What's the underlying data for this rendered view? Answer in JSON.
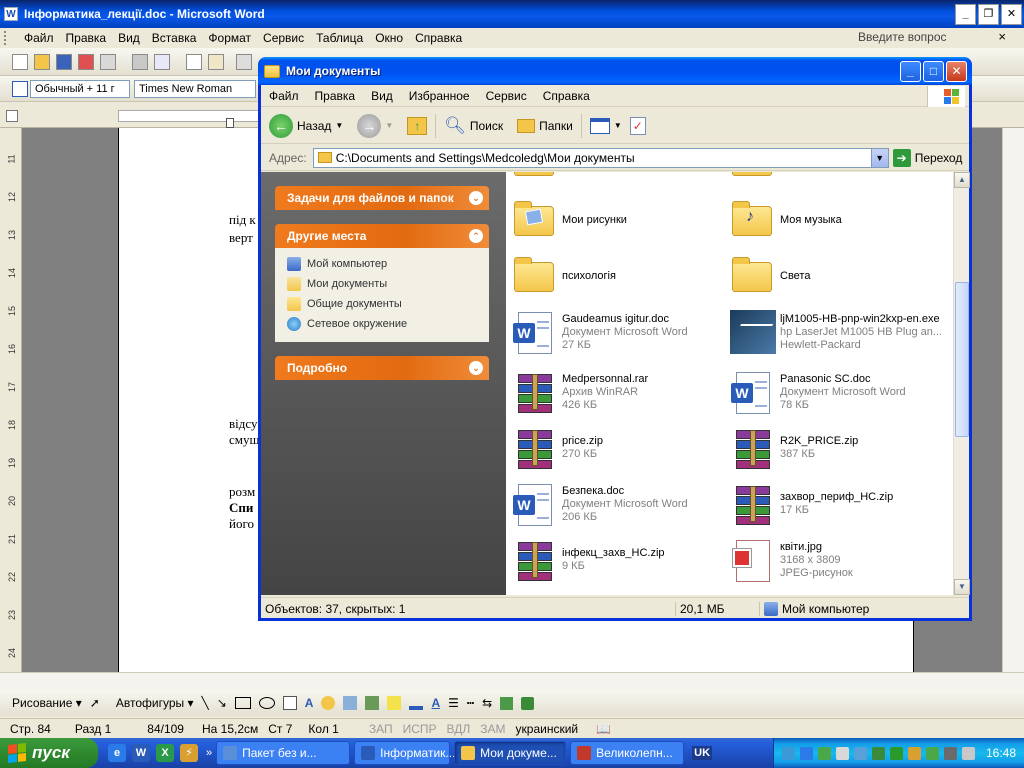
{
  "word": {
    "title": "Інформатика_лекції.doc - Microsoft Word",
    "app_icon_letter": "W",
    "controls": [
      "_",
      "❐",
      "✕"
    ],
    "menu": [
      "Файл",
      "Правка",
      "Вид",
      "Вставка",
      "Формат",
      "Сервис",
      "Таблица",
      "Окно",
      "Справка"
    ],
    "ask_placeholder": "Введите вопрос",
    "doc_close": "×",
    "style_value": "Обычный + 11 г",
    "font_value": "Times New Roman",
    "doc_fragments": [
      "під к",
      "верт",
      "відсу",
      "смущ",
      "розм",
      "Спи",
      "його"
    ],
    "vertical_ruler": [
      "11",
      "12",
      "13",
      "14",
      "15",
      "16",
      "17",
      "18",
      "19",
      "20",
      "21",
      "22",
      "23",
      "24"
    ],
    "draw_toolbar": {
      "draw_label": "Рисование ▾",
      "autoshapes_label": "Автофигуры ▾"
    },
    "status": {
      "page": "Стр. 84",
      "section": "Разд 1",
      "pages": "84/109",
      "at": "На 15,2см",
      "line": "Ст 7",
      "col": "Кол 1",
      "rec": "ЗАП",
      "trk": "ИСПР",
      "ext": "ВДЛ",
      "ovr": "ЗАМ",
      "lang": "украинский"
    }
  },
  "explorer": {
    "title": "Мои документы",
    "menu": [
      "Файл",
      "Правка",
      "Вид",
      "Избранное",
      "Сервис",
      "Справка"
    ],
    "toolbar": {
      "back": "Назад",
      "search": "Поиск",
      "folders": "Папки"
    },
    "address_label": "Адрес:",
    "address_value": "C:\\Documents and Settings\\Medcoledg\\Мои документы",
    "go_label": "Переход",
    "side": {
      "tasks_title": "Задачи для файлов и папок",
      "places_title": "Другие места",
      "places": [
        "Мой компьютер",
        "Мои документы",
        "Общие документы",
        "Сетевое окружение"
      ],
      "details_title": "Подробно"
    },
    "files": [
      {
        "name": "Мои рисунки",
        "type": "folder"
      },
      {
        "name": "Моя музыка",
        "type": "folder"
      },
      {
        "name": "психологія",
        "type": "folder"
      },
      {
        "name": "Света",
        "type": "folder"
      },
      {
        "name": "Gaudeamus igitur.doc",
        "line2": "Документ Microsoft Word",
        "line3": "27 КБ",
        "type": "doc"
      },
      {
        "name": "ljM1005-HB-pnp-win2kxp-en.exe",
        "line2": "hp LaserJet M1005 HB Plug an...",
        "line3": "Hewlett-Packard",
        "type": "exe"
      },
      {
        "name": "Medpersonnal.rar",
        "line2": "Архив WinRAR",
        "line3": "426 КБ",
        "type": "rar"
      },
      {
        "name": "Panasonic SC.doc",
        "line2": "Документ Microsoft Word",
        "line3": "78 КБ",
        "type": "doc"
      },
      {
        "name": "price.zip",
        "line2": "270 КБ",
        "type": "rar"
      },
      {
        "name": "R2K_PRICE.zip",
        "line2": "387 КБ",
        "type": "rar"
      },
      {
        "name": "Безпека.doc",
        "line2": "Документ Microsoft Word",
        "line3": "206 КБ",
        "type": "doc"
      },
      {
        "name": "захвор_периф_НС.zip",
        "line2": "17 КБ",
        "type": "rar"
      },
      {
        "name": "інфекц_захв_НС.zip",
        "line2": "9 КБ",
        "type": "rar"
      },
      {
        "name": "квіти.jpg",
        "line2": "3168 x 3809",
        "line3": "JPEG-рисунок",
        "type": "jpg"
      }
    ],
    "status": {
      "objects": "Объектов: 37, скрытых: 1",
      "size": "20,1 МБ",
      "zone": "Мой компьютер"
    }
  },
  "taskbar": {
    "start_label": "пуск",
    "buttons": [
      {
        "label": "Пакет без и...",
        "color": "#5a8fd8"
      },
      {
        "label": "Інформатик...",
        "color": "#2a5bb8"
      },
      {
        "label": "Мои докуме...",
        "color": "#f3c64a"
      },
      {
        "label": "Великолепн...",
        "color": "#c0392b"
      }
    ],
    "lang": "UK",
    "clock": "16:48"
  }
}
